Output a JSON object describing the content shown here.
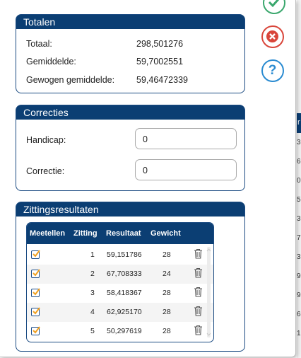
{
  "totalen": {
    "title": "Totalen",
    "rows": [
      {
        "label": "Totaal:",
        "value": "298,501276"
      },
      {
        "label": "Gemiddelde:",
        "value": "59,7002551"
      },
      {
        "label": "Gewogen gemiddelde:",
        "value": "59,46472339"
      }
    ]
  },
  "correcties": {
    "title": "Correcties",
    "handicap_label": "Handicap:",
    "handicap_value": "0",
    "correctie_label": "Correctie:",
    "correctie_value": "0"
  },
  "zitting": {
    "title": "Zittingsresultaten",
    "columns": [
      "Meetellen",
      "Zitting",
      "Resultaat",
      "Gewicht"
    ],
    "rows": [
      {
        "checked": true,
        "zitting": "1",
        "resultaat": "59,151786",
        "gewicht": "28"
      },
      {
        "checked": true,
        "zitting": "2",
        "resultaat": "67,708333",
        "gewicht": "24"
      },
      {
        "checked": true,
        "zitting": "3",
        "resultaat": "58,418367",
        "gewicht": "28"
      },
      {
        "checked": true,
        "zitting": "4",
        "resultaat": "62,925170",
        "gewicht": "28"
      },
      {
        "checked": true,
        "zitting": "5",
        "resultaat": "50,297619",
        "gewicht": "28"
      }
    ]
  },
  "actions": {
    "confirm_icon": "check-icon",
    "cancel_icon": "close-icon",
    "help_icon": "question-icon",
    "help_glyph": "?",
    "confirm_color": "#3aa76d",
    "cancel_color": "#d9463b",
    "help_color": "#2a8bd1"
  },
  "background": {
    "header_text": "r",
    "cells": [
      "3",
      "6",
      "0",
      "5",
      "3",
      "7",
      "3",
      "9",
      "9",
      "6",
      "1"
    ]
  },
  "colors": {
    "header_bg": "#0b3e73"
  }
}
